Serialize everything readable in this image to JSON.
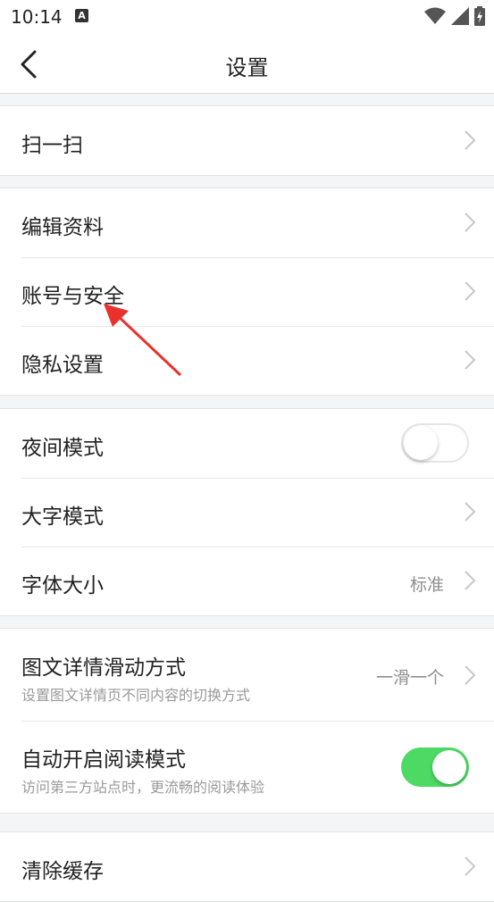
{
  "status_bar": {
    "time": "10:14",
    "app_icon_letter": "A"
  },
  "nav": {
    "title": "设置"
  },
  "groups": {
    "g1": [
      {
        "label": "扫一扫"
      }
    ],
    "g2": [
      {
        "label": "编辑资料"
      },
      {
        "label": "账号与安全"
      },
      {
        "label": "隐私设置"
      }
    ],
    "g3": [
      {
        "label": "夜间模式",
        "toggle": "off"
      },
      {
        "label": "大字模式"
      },
      {
        "label": "字体大小",
        "value": "标准"
      }
    ],
    "g4": [
      {
        "label": "图文详情滑动方式",
        "sub": "设置图文详情页不同内容的切换方式",
        "value": "一滑一个"
      },
      {
        "label": "自动开启阅读模式",
        "sub": "访问第三方站点时，更流畅的阅读体验",
        "toggle": "on"
      }
    ],
    "g5": [
      {
        "label": "清除缓存"
      }
    ]
  },
  "colors": {
    "toggle_on": "#4cd964",
    "annotation_arrow": "#e8322b"
  }
}
